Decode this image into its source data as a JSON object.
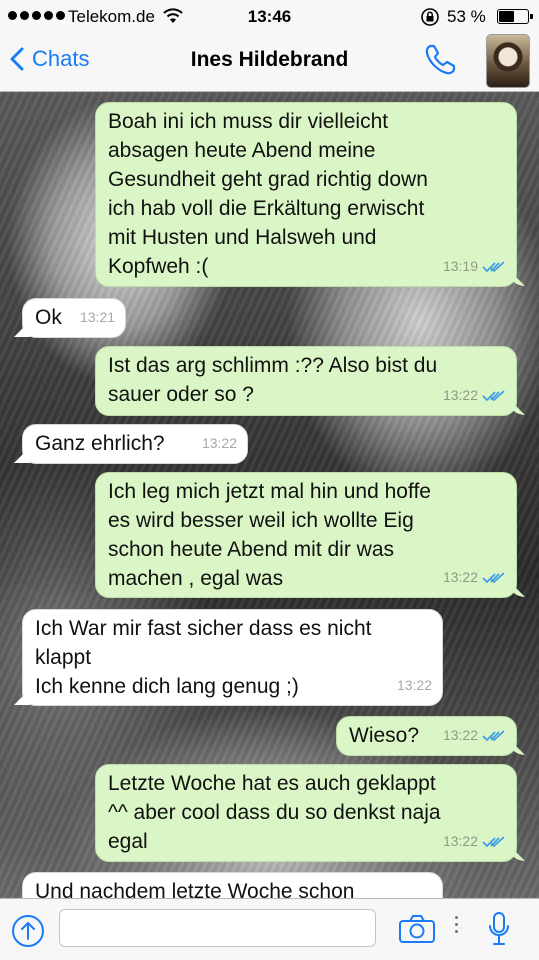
{
  "status_bar": {
    "carrier": "Telekom.de",
    "time": "13:46",
    "battery": "53 %",
    "battery_level": 0.53
  },
  "nav": {
    "back_label": "Chats",
    "contact_name": "Ines Hildebrand"
  },
  "colors": {
    "accent": "#1a7cf5",
    "outgoing_bubble": "#dbf6c6",
    "incoming_bubble": "#ffffff",
    "read_ticks": "#3fa0e6"
  },
  "icons": [
    "chevron-left-icon",
    "wifi-icon",
    "lock-rotation-icon",
    "battery-icon",
    "phone-icon",
    "share-icon",
    "camera-icon",
    "more-icon",
    "microphone-icon"
  ],
  "messages": [
    {
      "direction": "out",
      "text": "Boah ini ich muss dir vielleicht\nabsagen heute Abend meine\nGesundheit geht grad richtig down\nich hab voll die Erkältung erwischt\nmit Husten und Halsweh und\nKopfweh :(",
      "time": "13:19",
      "read": true
    },
    {
      "direction": "in",
      "text": "Ok",
      "time": "13:21"
    },
    {
      "direction": "out",
      "text": "Ist das arg schlimm :?? Also bist du\nsauer oder so ?",
      "time": "13:22",
      "read": true
    },
    {
      "direction": "in",
      "text": "Ganz ehrlich?",
      "time": "13:22"
    },
    {
      "direction": "out",
      "text": "Ich leg mich jetzt mal hin und hoffe\nes wird besser weil ich wollte Eig\nschon heute Abend mit dir was\nmachen , egal was",
      "time": "13:22",
      "read": true
    },
    {
      "direction": "in",
      "text": "Ich War mir fast sicher dass es nicht\nklappt\nIch kenne dich lang genug ;)",
      "time": "13:22"
    },
    {
      "direction": "out",
      "text": "Wieso?",
      "time": "13:22",
      "read": true
    },
    {
      "direction": "out",
      "text": "Letzte Woche hat es auch geklappt\n^^ aber cool dass du so denkst naja\negal",
      "time": "13:22",
      "read": true
    },
    {
      "direction": "in",
      "text": "Und nachdem letzte Woche schon",
      "time": ""
    }
  ],
  "input": {
    "value": "",
    "placeholder": ""
  }
}
